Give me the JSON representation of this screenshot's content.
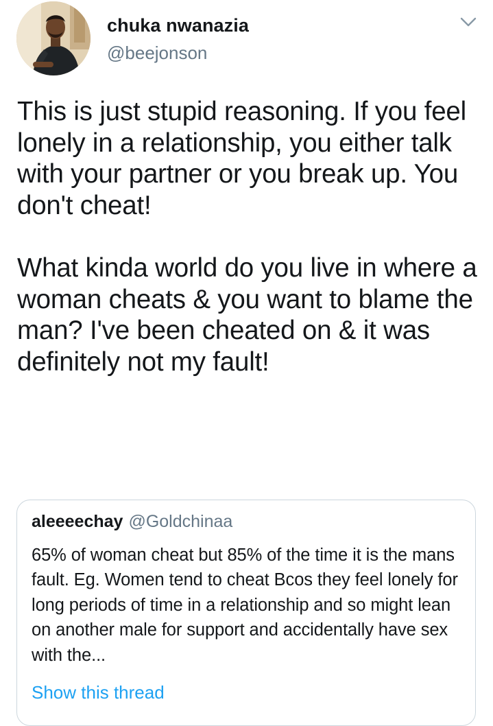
{
  "tweet": {
    "author": {
      "name": "chuka nwanazia",
      "handle": "@beejonson"
    },
    "menu_icon": "chevron-down-icon",
    "body": {
      "paragraph_1": "This is just stupid reasoning. If you feel lonely in a relationship, you either talk with your partner or you break up. You don't cheat!",
      "paragraph_2": "What kinda world do you live in where a woman cheats & you want to blame the man? I've been cheated on & it was definitely not my fault!"
    },
    "quoted_tweet": {
      "name": "aleeeechay",
      "handle": "@Goldchinaa",
      "text": "65% of woman cheat but 85% of the time it is the mans fault. Eg. Women tend to cheat Bcos they feel lonely for long periods of time in a relationship and so might lean on another male for support and accidentally have sex with the...",
      "show_thread_label": "Show this thread"
    }
  },
  "colors": {
    "text_primary": "#14171a",
    "text_secondary": "#657786",
    "link": "#1da1f2",
    "border": "#ccd6dd"
  }
}
